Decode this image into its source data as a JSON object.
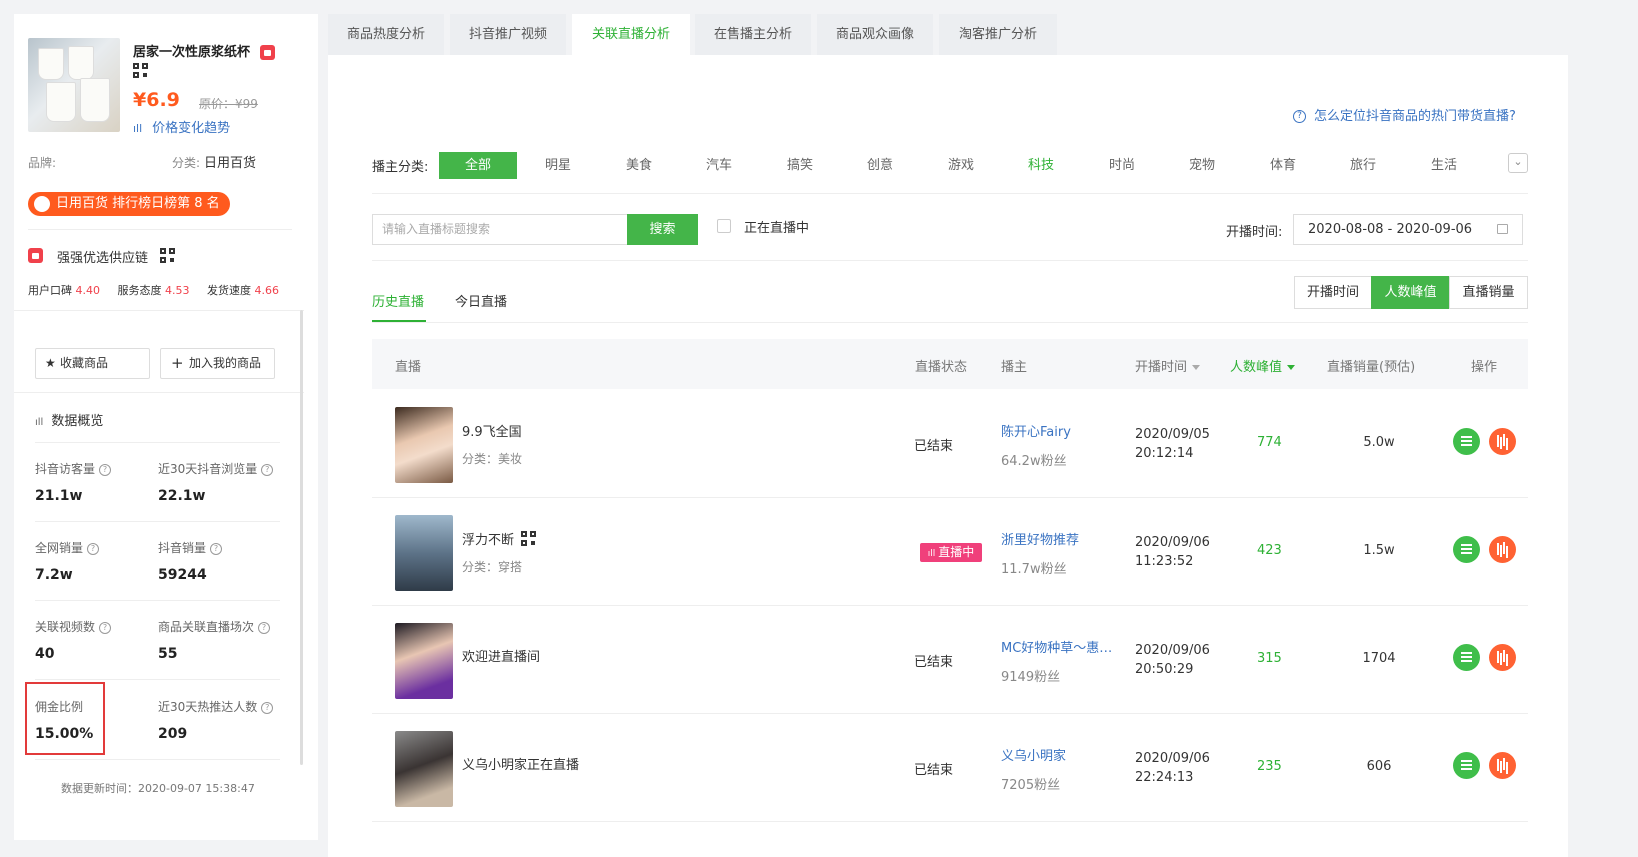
{
  "product": {
    "title": "居家一次性原浆纸杯",
    "price": "¥6.9",
    "original_price": "原价：¥99",
    "trend_link": "价格变化趋势",
    "brand_label": "品牌:",
    "category_label": "分类:",
    "category_value": "日用百货",
    "rank_badge": "日用百货 排行榜日榜第 8 名"
  },
  "supplier": {
    "name": "强强优选供应链",
    "ratings": [
      {
        "label": "用户口碑",
        "value": "4.40"
      },
      {
        "label": "服务态度",
        "value": "4.53"
      },
      {
        "label": "发货速度",
        "value": "4.66"
      }
    ]
  },
  "actions": {
    "favorite": "收藏商品",
    "add_mine": "加入我的商品"
  },
  "overview": {
    "title": "数据概览",
    "stats": [
      {
        "label": "抖音访客量",
        "value": "21.1w"
      },
      {
        "label": "近30天抖音浏览量",
        "value": "22.1w"
      },
      {
        "label": "全网销量",
        "value": "7.2w"
      },
      {
        "label": "抖音销量",
        "value": "59244"
      },
      {
        "label": "关联视频数",
        "value": "40"
      },
      {
        "label": "商品关联直播场次",
        "value": "55"
      },
      {
        "label": "佣金比例",
        "value": "15.00%"
      },
      {
        "label": "近30天热推达人数",
        "value": "209"
      }
    ],
    "updated": "数据更新时间：2020-09-07 15:38:47"
  },
  "tabs": [
    "商品热度分析",
    "抖音推广视频",
    "关联直播分析",
    "在售播主分析",
    "商品观众画像",
    "淘客推广分析"
  ],
  "help_link": "怎么定位抖音商品的热门带货直播?",
  "filter": {
    "label": "播主分类:",
    "categories": [
      "全部",
      "明星",
      "美食",
      "汽车",
      "搞笑",
      "创意",
      "游戏",
      "科技",
      "时尚",
      "宠物",
      "体育",
      "旅行",
      "生活"
    ]
  },
  "search": {
    "placeholder": "请输入直播标题搜索",
    "button": "搜索",
    "live_only": "正在直播中",
    "date_label": "开播时间:",
    "date_range": "2020-08-08 - 2020-09-06"
  },
  "subtabs": [
    "历史直播",
    "今日直播"
  ],
  "sort_buttons": [
    "开播时间",
    "人数峰值",
    "直播销量"
  ],
  "table": {
    "headers": [
      "直播",
      "直播状态",
      "播主",
      "开播时间",
      "人数峰值",
      "直播销量(预估)",
      "操作"
    ],
    "rows": [
      {
        "title": "9.9飞全国",
        "category": "分类：美妆",
        "status": "已结束",
        "anchor": "陈开心Fairy",
        "fans": "64.2w粉丝",
        "date": "2020/09/05",
        "time": "20:12:14",
        "peak": "774",
        "sales": "5.0w"
      },
      {
        "title": "浮力不断",
        "category": "分类：穿搭",
        "status": "直播中",
        "anchor": "浙里好物推荐",
        "fans": "11.7w粉丝",
        "date": "2020/09/06",
        "time": "11:23:52",
        "peak": "423",
        "sales": "1.5w"
      },
      {
        "title": "欢迎进直播间",
        "category": "",
        "status": "已结束",
        "anchor": "MC好物种草～惠…",
        "fans": "9149粉丝",
        "date": "2020/09/06",
        "time": "20:50:29",
        "peak": "315",
        "sales": "1704"
      },
      {
        "title": "义乌小明家正在直播",
        "category": "",
        "status": "已结束",
        "anchor": "义乌小明家",
        "fans": "7205粉丝",
        "date": "2020/09/06",
        "time": "22:24:13",
        "peak": "235",
        "sales": "606"
      }
    ]
  }
}
